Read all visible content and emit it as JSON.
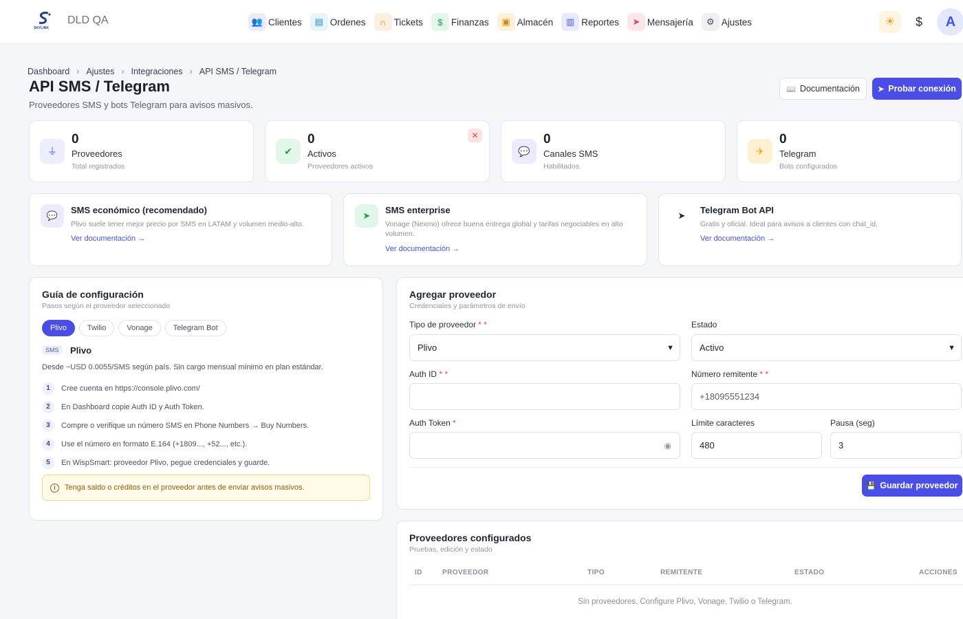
{
  "app": {
    "brand": "DLD QA",
    "logo_text": "SKYLINK"
  },
  "nav": [
    {
      "label": "Clientes",
      "icon": "users-icon"
    },
    {
      "label": "Ordenes",
      "icon": "document-icon"
    },
    {
      "label": "Tickets",
      "icon": "headset-icon"
    },
    {
      "label": "Finanzas",
      "icon": "dollar-icon"
    },
    {
      "label": "Almacén",
      "icon": "box-icon"
    },
    {
      "label": "Reportes",
      "icon": "chart-icon"
    },
    {
      "label": "Mensajería",
      "icon": "send-icon"
    },
    {
      "label": "Ajustes",
      "icon": "gear-icon"
    }
  ],
  "user": {
    "avatar": "A"
  },
  "breadcrumb": [
    "Dashboard",
    "Ajustes",
    "Integraciones",
    "API SMS / Telegram"
  ],
  "header": {
    "title": "API SMS / Telegram",
    "subtitle": "Proveedores SMS y bots Telegram para avisos masivos.",
    "doc_button": "Documentación",
    "test_button": "Probar conexión"
  },
  "stats": [
    {
      "value": "0",
      "label": "Proveedores",
      "sub": "Total registrados",
      "color": "#5b5ee8"
    },
    {
      "value": "0",
      "label": "Activos",
      "sub": "Proveedores activos",
      "color": "#16a34a"
    },
    {
      "value": "0",
      "label": "Canales SMS",
      "sub": "Habilitados",
      "color": "#8b5cf6"
    },
    {
      "value": "0",
      "label": "Telegram",
      "sub": "Bots configurados",
      "color": "#f59e0b"
    }
  ],
  "info_cards": [
    {
      "title": "SMS económico (recomendado)",
      "desc": "Plivo suele tener mejor precio por SMS en LATAM y volumen medio-alto.",
      "link": "Ver documentación →"
    },
    {
      "title": "SMS enterprise",
      "desc": "Vonage (Nexmo) ofrece buena entrega global y tarifas negociables en alto volumen.",
      "link": "Ver documentación →"
    },
    {
      "title": "Telegram Bot API",
      "desc": "Gratis y oficial. Ideal para avisos a clientes con chat_id.",
      "link": "Ver documentación →"
    }
  ],
  "guide": {
    "title": "Guía de configuración",
    "subtitle": "Pasos según el proveedor seleccionado",
    "tabs": [
      "Plivo",
      "Twilio",
      "Vonage",
      "Telegram Bot"
    ],
    "badge": "SMS",
    "name": "Plivo",
    "desc": "Desde ~USD 0.0055/SMS según país. Sin cargo mensual mínimo en plan estándar.",
    "steps": [
      {
        "n": "1",
        "text": "Cree cuenta en https://console.plivo.com/"
      },
      {
        "n": "2",
        "text": "En Dashboard copie Auth ID y Auth Token."
      },
      {
        "n": "3",
        "text": "Compre o verifique un número SMS en Phone Numbers → Buy Numbers."
      },
      {
        "n": "4",
        "text": "Use el número en formato E.164 (+1809..., +52..., etc.)."
      },
      {
        "n": "5",
        "text": "En WispSmart: proveedor Plivo, pegue credenciales y guarde."
      }
    ],
    "warning": "Tenga saldo o créditos en el proveedor antes de enviar avisos masivos."
  },
  "form": {
    "title": "Agregar proveedor",
    "subtitle": "Credenciales y parámetros de envío",
    "provider_type_label": "Tipo de proveedor",
    "provider_type_value": "Plivo",
    "status_label": "Estado",
    "status_value": "Activo",
    "auth_id_label": "Auth ID",
    "auth_id_value": "",
    "sender_label": "Número remitente",
    "sender_placeholder": "+18095551234",
    "auth_token_label": "Auth Token",
    "auth_token_value": "",
    "char_limit_label": "Límite caracteres",
    "char_limit_value": "480",
    "pause_label": "Pausa (seg)",
    "pause_value": "3",
    "save_button": "Guardar proveedor"
  },
  "providers_table": {
    "title": "Proveedores configurados",
    "subtitle": "Pruebas, edición y estado",
    "columns": [
      "ID",
      "PROVEEDOR",
      "TIPO",
      "REMITENTE",
      "ESTADO",
      "ACCIONES"
    ],
    "empty": "Sin proveedores. Configure Plivo, Vonage, Twilio o Telegram."
  }
}
